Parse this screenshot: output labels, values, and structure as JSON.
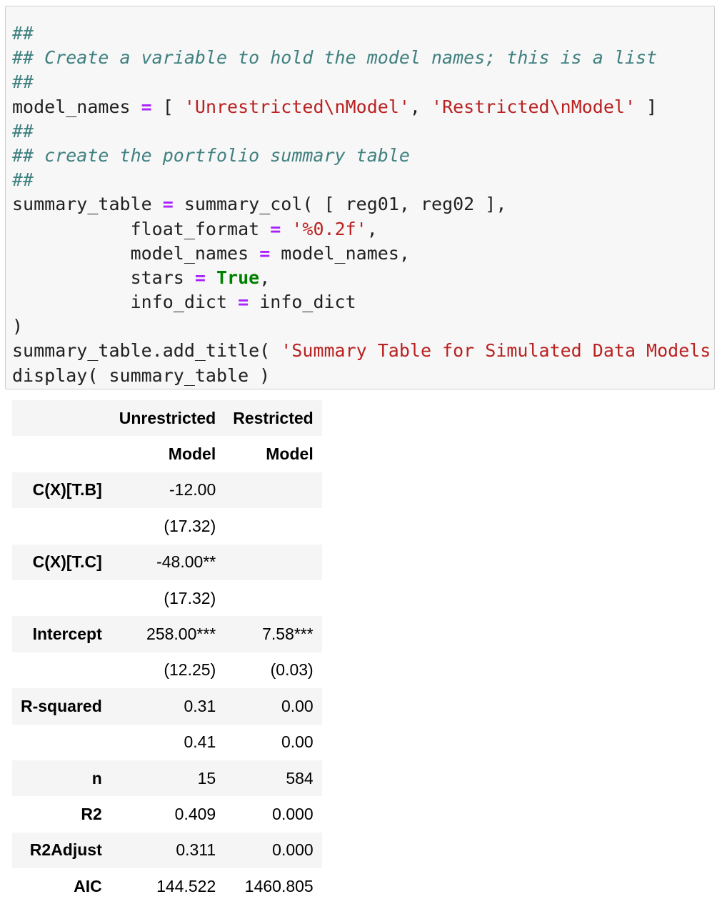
{
  "code_cell": {
    "lines": [
      [
        {
          "c": "comment",
          "t": "##"
        }
      ],
      [
        {
          "c": "comment",
          "t": "## Create a variable to hold the model names; this is a list"
        }
      ],
      [
        {
          "c": "comment",
          "t": "##"
        }
      ],
      [
        {
          "c": "plain",
          "t": "model_names "
        },
        {
          "c": "op",
          "t": "="
        },
        {
          "c": "plain",
          "t": " [ "
        },
        {
          "c": "str",
          "t": "'Unrestricted\\nModel'"
        },
        {
          "c": "plain",
          "t": ", "
        },
        {
          "c": "str",
          "t": "'Restricted\\nModel'"
        },
        {
          "c": "plain",
          "t": " ]"
        }
      ],
      [
        {
          "c": "comment",
          "t": "##"
        }
      ],
      [
        {
          "c": "comment",
          "t": "## create the portfolio summary table"
        }
      ],
      [
        {
          "c": "comment",
          "t": "##"
        }
      ],
      [
        {
          "c": "plain",
          "t": "summary_table "
        },
        {
          "c": "op",
          "t": "="
        },
        {
          "c": "plain",
          "t": " summary_col( [ reg01, reg02 ],"
        }
      ],
      [
        {
          "c": "plain",
          "t": "           float_format "
        },
        {
          "c": "op",
          "t": "="
        },
        {
          "c": "plain",
          "t": " "
        },
        {
          "c": "str",
          "t": "'%0.2f'"
        },
        {
          "c": "plain",
          "t": ","
        }
      ],
      [
        {
          "c": "plain",
          "t": "           model_names "
        },
        {
          "c": "op",
          "t": "="
        },
        {
          "c": "plain",
          "t": " model_names,"
        }
      ],
      [
        {
          "c": "plain",
          "t": "           stars "
        },
        {
          "c": "op",
          "t": "="
        },
        {
          "c": "plain",
          "t": " "
        },
        {
          "c": "kw",
          "t": "True"
        },
        {
          "c": "plain",
          "t": ","
        }
      ],
      [
        {
          "c": "plain",
          "t": "           info_dict "
        },
        {
          "c": "op",
          "t": "="
        },
        {
          "c": "plain",
          "t": " info_dict"
        }
      ],
      [
        {
          "c": "plain",
          "t": ")"
        }
      ],
      [
        {
          "c": "plain",
          "t": "summary_table.add_title( "
        },
        {
          "c": "str",
          "t": "'Summary Table for Simulated Data Models'"
        },
        {
          "c": "plain",
          "t": " )"
        }
      ],
      [
        {
          "c": "plain",
          "t": "display( summary_table )"
        }
      ]
    ]
  },
  "output_table": {
    "header_rows": [
      [
        "",
        "Unrestricted",
        "Restricted"
      ],
      [
        "",
        "Model",
        "Model"
      ]
    ],
    "rows": [
      [
        "C(X)[T.B]",
        "-12.00",
        ""
      ],
      [
        "",
        "(17.32)",
        ""
      ],
      [
        "C(X)[T.C]",
        "-48.00**",
        ""
      ],
      [
        "",
        "(17.32)",
        ""
      ],
      [
        "Intercept",
        "258.00***",
        "7.58***"
      ],
      [
        "",
        "(12.25)",
        "(0.03)"
      ],
      [
        "R-squared",
        "0.31",
        "0.00"
      ],
      [
        "",
        "0.41",
        "0.00"
      ],
      [
        "n",
        "15",
        "584"
      ],
      [
        "R2",
        "0.409",
        "0.000"
      ],
      [
        "R2Adjust",
        "0.311",
        "0.000"
      ],
      [
        "AIC",
        "144.522",
        "1460.805"
      ]
    ]
  },
  "colors": {
    "comment": "#408080",
    "operator": "#aa22ff",
    "string": "#ba2121",
    "keyword": "#008000",
    "cell_background": "#f7f7f7",
    "cell_border": "#cfcfcf",
    "row_stripe": "#f5f5f5"
  }
}
